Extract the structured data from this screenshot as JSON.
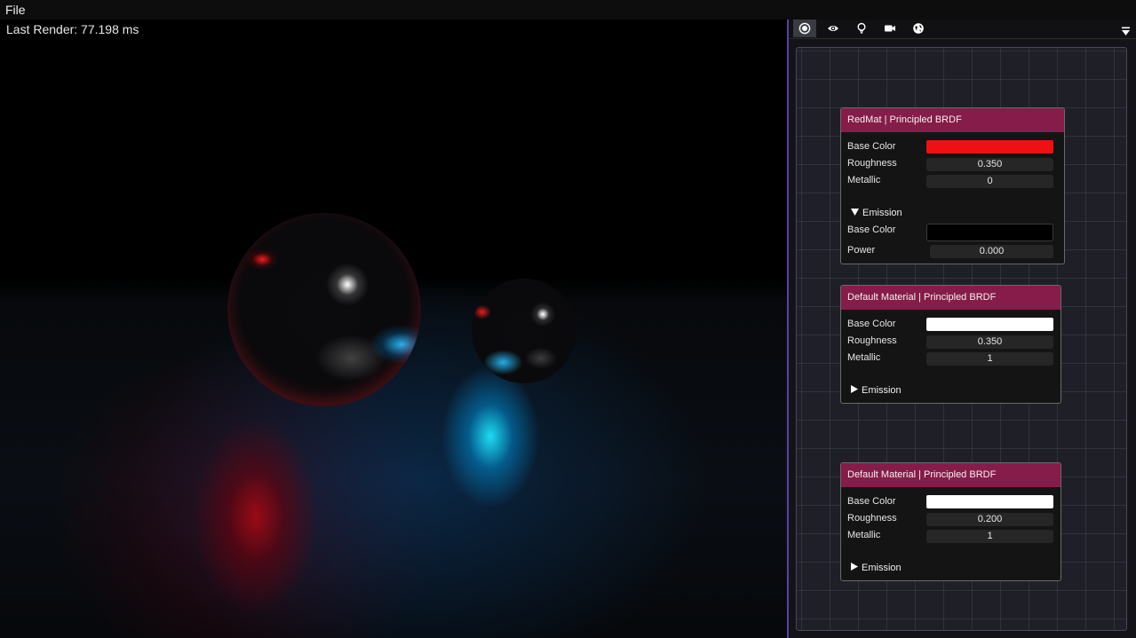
{
  "menu": {
    "file_label": "File"
  },
  "viewport": {
    "last_render": "Last Render: 77.198 ms"
  },
  "toolbar": {
    "icons": [
      "record-icon",
      "eye-icon",
      "lightbulb-icon",
      "camera-icon",
      "globe-icon"
    ],
    "menu_icon": "dropdown-triangle-icon"
  },
  "nodes": [
    {
      "title": "RedMat | Principled BRDF",
      "base_color_label": "Base Color",
      "base_color": "#ee1111",
      "roughness_label": "Roughness",
      "roughness": "0.350",
      "metallic_label": "Metallic",
      "metallic": "0",
      "emission_label": "Emission",
      "emission_expanded": true,
      "emission_base_color_label": "Base Color",
      "emission_base_color": "#000000",
      "power_label": "Power",
      "power": "0.000"
    },
    {
      "title": "Default Material | Principled BRDF",
      "base_color_label": "Base Color",
      "base_color": "#ffffff",
      "roughness_label": "Roughness",
      "roughness": "0.350",
      "metallic_label": "Metallic",
      "metallic": "1",
      "emission_label": "Emission",
      "emission_expanded": false
    },
    {
      "title": "Default Material | Principled BRDF",
      "base_color_label": "Base Color",
      "base_color": "#ffffff",
      "roughness_label": "Roughness",
      "roughness": "0.200",
      "metallic_label": "Metallic",
      "metallic": "1",
      "emission_label": "Emission",
      "emission_expanded": false
    }
  ],
  "colors": {
    "accent": "#5b40a8",
    "node_header": "#861c49"
  }
}
